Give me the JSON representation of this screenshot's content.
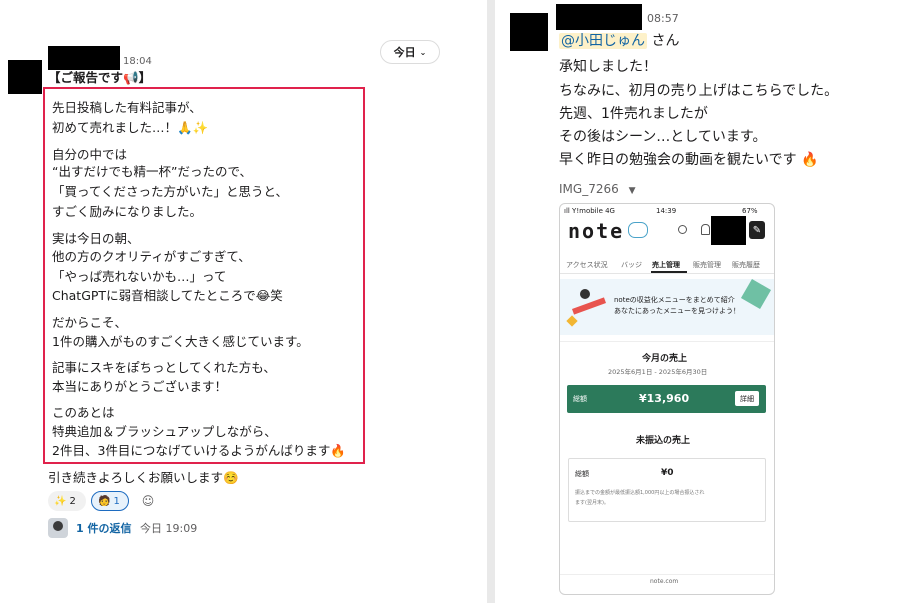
{
  "left": {
    "timestamp": "18:04",
    "date_pill": "今日",
    "message_lines": [
      "【ご報告です📢】",
      "先日投稿した有料記事が、",
      "初めて売れました…！🙏✨",
      "自分の中では",
      "“出すだけでも精一杯”だったので、",
      "「買ってくださった方がいた」と思うと、",
      "すごく励みになりました。",
      "実は今日の朝、",
      "他の方のクオリティがすごすぎて、",
      "「やっぱ売れないかも…」って",
      "ChatGPTに弱音相談してたところで😂笑",
      "だからこそ、",
      "1件の購入がものすごく大きく感じています。",
      "記事にスキをぽちっとしてくれた方も、",
      "本当にありがとうございます！",
      "このあとは",
      "特典追加＆ブラッシュアップしながら、",
      "2件目、3件目につなげていけるようがんばります🔥",
      "引き続きよろしくお願いします☺️"
    ],
    "reactions": [
      {
        "emoji": "✨",
        "count": "2"
      },
      {
        "emoji": "🧑",
        "count": "1"
      }
    ],
    "reply": {
      "count_label": "1 件の返信",
      "time": "今日 19:09"
    }
  },
  "right": {
    "timestamp": "08:57",
    "mention": "@小田じゅん",
    "after_mention": " さん",
    "lines": [
      "承知しました！",
      "ちなみに、初月の売り上げはこちらでした。",
      "先週、1件売れましたが",
      "その後はシーン…としています。",
      "早く昨日の勉強会の動画を観たいです 🔥"
    ],
    "attachment_name": "IMG_7266",
    "phone": {
      "status_carrier": "ıll Y!mobile 4G",
      "status_time": "14:39",
      "status_battery": "67%",
      "logo": "note",
      "tabs": [
        "アクセス状況",
        "バッジ",
        "売上管理",
        "販売管理",
        "販売履歴"
      ],
      "active_tab": "売上管理",
      "banner_line1": "noteの収益化メニューをまとめて紹介",
      "banner_line2": "あなたにあったメニューを見つけよう！",
      "month_title": "今月の売上",
      "month_period": "2025年6月1日 - 2025年6月30日",
      "total_label": "総額",
      "total_amount": "¥13,960",
      "detail_button": "詳細",
      "unpaid_title": "未振込の売上",
      "unpaid_label": "総額",
      "unpaid_amount": "¥0",
      "unpaid_note1": "振込までの金額が最低振込額1,000円以上の場合振込され",
      "unpaid_note2": "ます(翌月末)。",
      "footer": "note.com",
      "brand_color": "#2c7a5b"
    }
  }
}
